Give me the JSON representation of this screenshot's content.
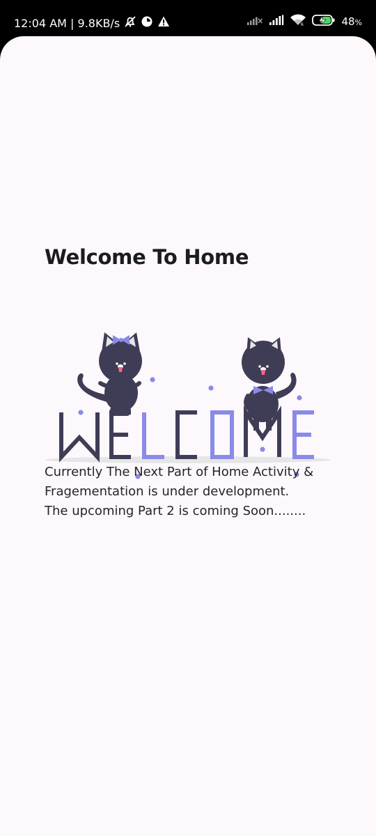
{
  "status_bar": {
    "time_speed": "12:04 AM | 9.8KB/s",
    "battery": "48",
    "battery_unit": "%",
    "icons": [
      "mute-bell-icon",
      "data-saver-icon",
      "warning-icon",
      "signal-x-icon",
      "signal-icon",
      "wifi-icon",
      "battery-charging-icon"
    ]
  },
  "home": {
    "title": "Welcome To Home",
    "illustration": {
      "letters": [
        "W",
        "E",
        "L",
        "C",
        "O",
        "M",
        "E"
      ],
      "colors": {
        "dark": "#3f3d56",
        "accent": "#8a8ae8",
        "shadow": "#e6e6e6"
      }
    },
    "message": "Currently The Next Part of Home Activity &\n Fragementation is under development.\n The upcoming Part 2 is coming Soon........"
  }
}
